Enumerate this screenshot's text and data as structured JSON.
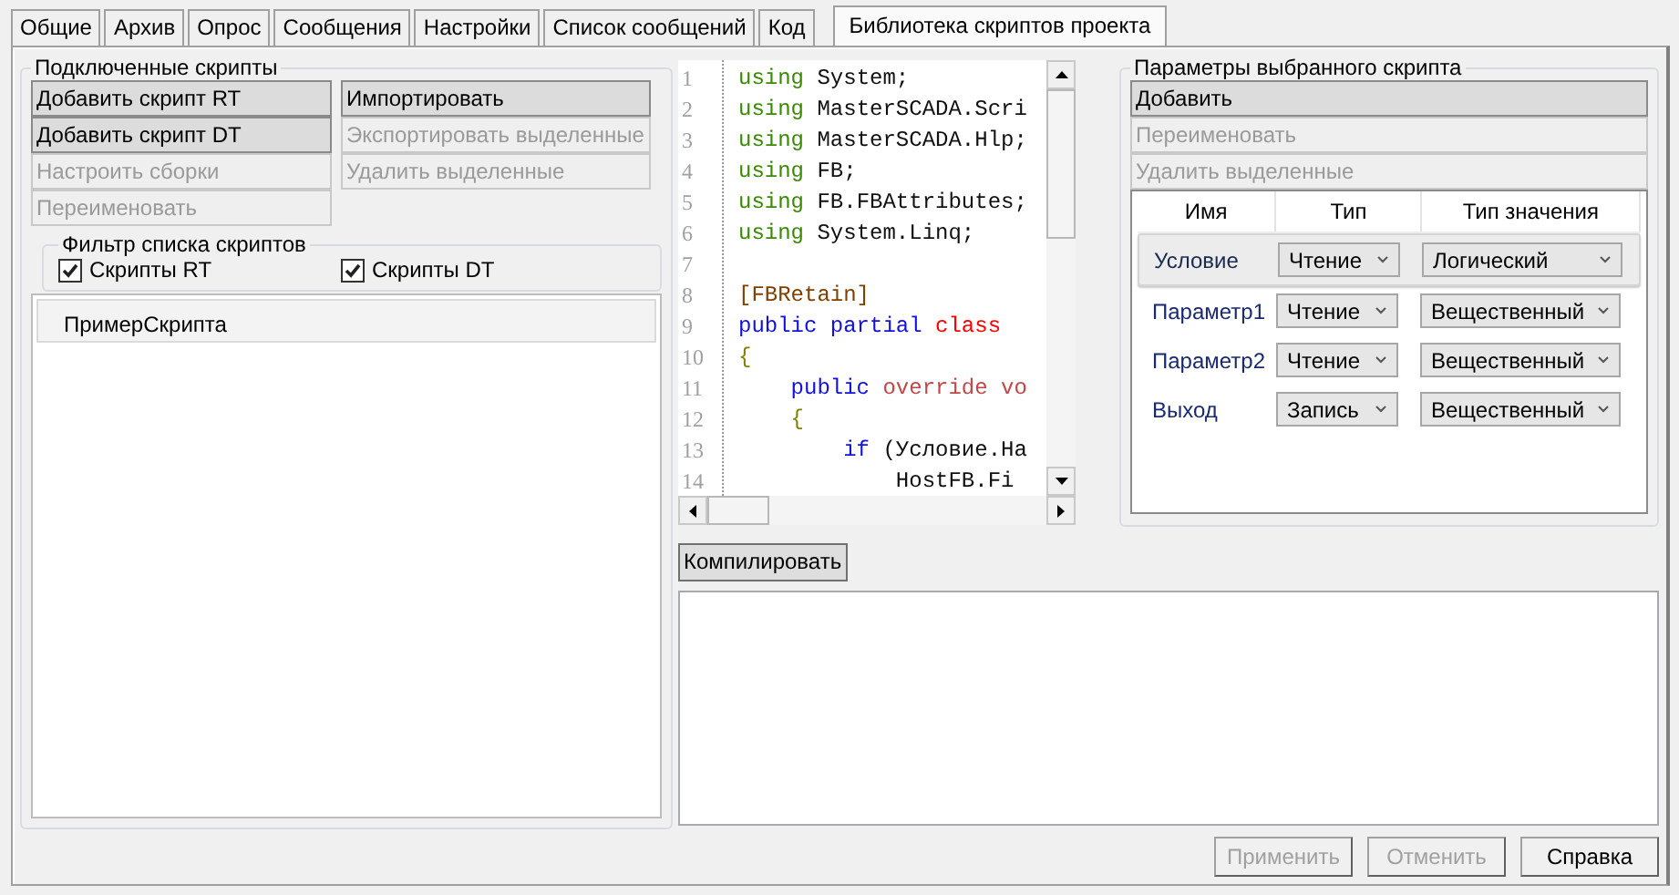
{
  "tabs": [
    {
      "label": "Общие",
      "selected": false
    },
    {
      "label": "Архив",
      "selected": false
    },
    {
      "label": "Опрос",
      "selected": false
    },
    {
      "label": "Сообщения",
      "selected": false
    },
    {
      "label": "Настройки",
      "selected": false
    },
    {
      "label": "Список сообщений",
      "selected": false
    },
    {
      "label": "Код",
      "selected": false
    },
    {
      "label": "Библиотека скриптов проекта",
      "selected": true
    }
  ],
  "scripts_group": {
    "title": "Подключенные скрипты",
    "buttons_left": [
      {
        "label": "Добавить скрипт RT",
        "disabled": false
      },
      {
        "label": "Добавить скрипт DT",
        "disabled": false
      },
      {
        "label": "Настроить сборки",
        "disabled": true
      },
      {
        "label": "Переименовать",
        "disabled": true
      }
    ],
    "buttons_right": [
      {
        "label": "Импортировать",
        "disabled": false
      },
      {
        "label": "Экспортировать выделенные",
        "disabled": true
      },
      {
        "label": "Удалить выделенные",
        "disabled": true
      }
    ],
    "filter": {
      "title": "Фильтр списка скриптов",
      "checkboxes": [
        {
          "label": "Скрипты RT",
          "checked": true
        },
        {
          "label": "Скрипты DT",
          "checked": true
        }
      ]
    },
    "scripts": [
      {
        "label": "ПримерСкрипта",
        "selected": true
      }
    ]
  },
  "editor": {
    "lines": [
      {
        "number": "1",
        "tokens": [
          {
            "text": "using",
            "kind": "using"
          },
          {
            "text": " System;",
            "kind": "plain"
          }
        ]
      },
      {
        "number": "2",
        "tokens": [
          {
            "text": "using",
            "kind": "using"
          },
          {
            "text": " MasterSCADA.Scri",
            "kind": "plain"
          }
        ]
      },
      {
        "number": "3",
        "tokens": [
          {
            "text": "using",
            "kind": "using"
          },
          {
            "text": " MasterSCADA.Hlp;",
            "kind": "plain"
          }
        ]
      },
      {
        "number": "4",
        "tokens": [
          {
            "text": "using",
            "kind": "using"
          },
          {
            "text": " FB;",
            "kind": "plain"
          }
        ]
      },
      {
        "number": "5",
        "tokens": [
          {
            "text": "using",
            "kind": "using"
          },
          {
            "text": " FB.FBAttributes;",
            "kind": "plain"
          }
        ]
      },
      {
        "number": "6",
        "tokens": [
          {
            "text": "using",
            "kind": "using"
          },
          {
            "text": " System.Linq;",
            "kind": "plain"
          }
        ]
      },
      {
        "number": "7"
      },
      {
        "number": "8",
        "tokens": [
          {
            "text": "[FBRetain]",
            "kind": "attribute"
          }
        ]
      },
      {
        "number": "9",
        "tokens": [
          {
            "text": "public partial",
            "kind": "keyword"
          },
          {
            "text": " class",
            "kind": "class"
          }
        ]
      },
      {
        "number": "10",
        "tokens": [
          {
            "text": "{",
            "kind": "brace"
          }
        ]
      },
      {
        "number": "11",
        "tokens": [
          {
            "text": "    public",
            "kind": "keyword"
          },
          {
            "text": " override vo",
            "kind": "modifier"
          }
        ]
      },
      {
        "number": "12",
        "tokens": [
          {
            "text": "    {",
            "kind": "brace"
          }
        ]
      },
      {
        "number": "13",
        "tokens": [
          {
            "text": "        if",
            "kind": "keyword"
          },
          {
            "text": " (Условие.На",
            "kind": "plain"
          }
        ]
      },
      {
        "number": "14",
        "tokens": [
          {
            "text": "            HostFB.Fi",
            "kind": "plain"
          }
        ]
      }
    ]
  },
  "compile_button": {
    "label": "Компилировать"
  },
  "params_group": {
    "title": "Параметры выбранного скрипта",
    "buttons": [
      {
        "label": "Добавить",
        "disabled": false
      },
      {
        "label": "Переименовать",
        "disabled": true
      },
      {
        "label": "Удалить выделенные",
        "disabled": true
      }
    ],
    "columns": [
      "Имя",
      "Тип",
      "Тип значения"
    ],
    "rows": [
      {
        "name": "Условие",
        "type": "Чтение",
        "value_type": "Логический",
        "selected": true
      },
      {
        "name": "Параметр1",
        "type": "Чтение",
        "value_type": "Вещественный",
        "selected": false
      },
      {
        "name": "Параметр2",
        "type": "Чтение",
        "value_type": "Вещественный",
        "selected": false
      },
      {
        "name": "Выход",
        "type": "Запись",
        "value_type": "Вещественный",
        "selected": false
      }
    ]
  },
  "footer_buttons": [
    {
      "label": "Применить",
      "disabled": true
    },
    {
      "label": "Отменить",
      "disabled": true
    },
    {
      "label": "Справка",
      "disabled": false
    }
  ]
}
